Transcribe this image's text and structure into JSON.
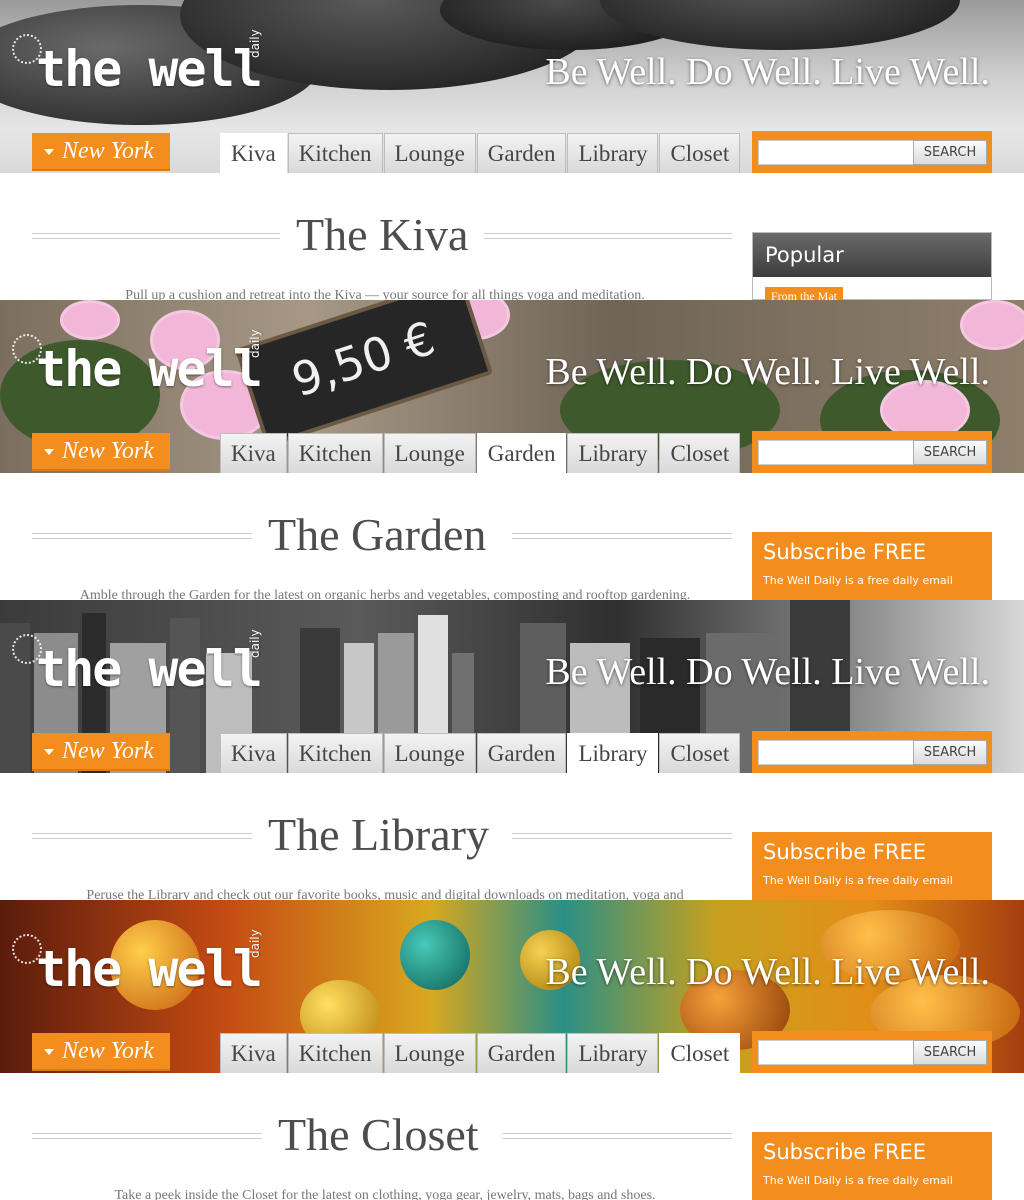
{
  "brand": {
    "logo_text": "the well",
    "logo_daily": "daily",
    "tagline": "Be Well. Do Well. Live Well."
  },
  "city": {
    "label": "New York"
  },
  "tabs": [
    "Kiva",
    "Kitchen",
    "Lounge",
    "Garden",
    "Library",
    "Closet"
  ],
  "search": {
    "button_label": "SEARCH",
    "placeholder": ""
  },
  "sidebar": {
    "popular": {
      "title": "Popular",
      "tag": "From the Mat"
    },
    "subscribe": {
      "title": "Subscribe FREE",
      "desc": "The Well Daily is a free daily email"
    }
  },
  "chalkboard": {
    "price": "9,50 €"
  },
  "sections": [
    {
      "name": "Kiva",
      "active_tab": 0,
      "title": "The Kiva",
      "intro": "Pull up a cushion and retreat into the Kiva — your source for all things yoga and meditation.",
      "sidebar": "popular"
    },
    {
      "name": "Garden",
      "active_tab": 3,
      "title": "The Garden",
      "intro": "Amble through the Garden for the latest on organic herbs and vegetables, composting and rooftop gardening.",
      "sidebar": "subscribe"
    },
    {
      "name": "Library",
      "active_tab": 4,
      "title": "The Library",
      "intro": "Peruse the Library and check out our favorite books, music and digital downloads on meditation, yoga and",
      "sidebar": "subscribe"
    },
    {
      "name": "Closet",
      "active_tab": 5,
      "title": "The Closet",
      "intro": "Take a peek inside the Closet for the latest on clothing, yoga gear, jewelry, mats, bags and shoes.",
      "sidebar": "subscribe"
    }
  ]
}
